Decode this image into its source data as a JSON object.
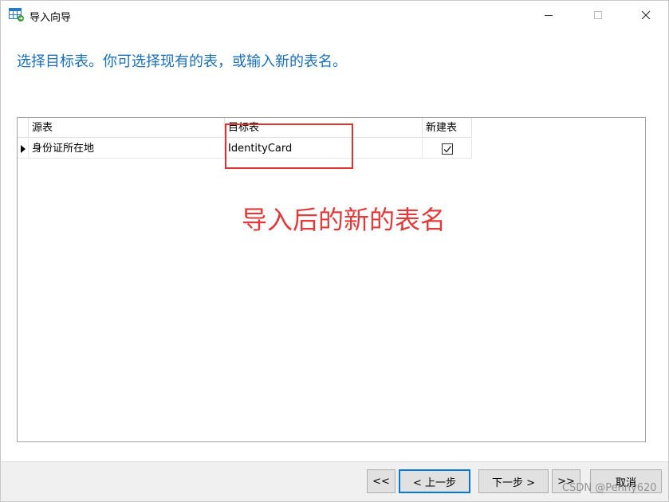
{
  "window": {
    "title": "导入向导"
  },
  "instruction": "选择目标表。你可选择现有的表，或输入新的表名。",
  "grid": {
    "columns": [
      "源表",
      "目标表",
      "新建表"
    ],
    "rows": [
      {
        "source": "身份证所在地",
        "target": "IdentityCard",
        "new_table": true
      }
    ]
  },
  "annotation": {
    "text": "导入后的新的表名",
    "color": "#e03a3a"
  },
  "buttons": {
    "first": "<<",
    "prev": "< 上一步",
    "next": "下一步 >",
    "last": ">>",
    "cancel": "取消"
  },
  "watermark": "CSDN @Penny620",
  "colors": {
    "accent": "#1a6fb6",
    "focus": "#0078d7"
  }
}
